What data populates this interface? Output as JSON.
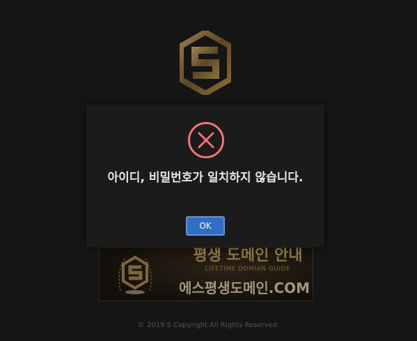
{
  "logo": {
    "icon": "s-hexagon-logo-icon"
  },
  "banner": {
    "title": "평생 도메인 안내",
    "subtitle": "LIFETIME DOMIAN GUIDE",
    "domain": "에스평생도메인.COM"
  },
  "footer": {
    "copyright": "© 2019 S Copyright All Rights Reserved."
  },
  "dialog": {
    "icon": "error-x-circle-icon",
    "message": "아이디, 비밀번호가 일치하지 않습니다.",
    "ok_label": "OK"
  },
  "colors": {
    "background": "#1d1d1d",
    "dialog": "#1b1b1b",
    "error": "#f27474",
    "button": "#2f6fc9",
    "gold": "#b89a5c"
  }
}
